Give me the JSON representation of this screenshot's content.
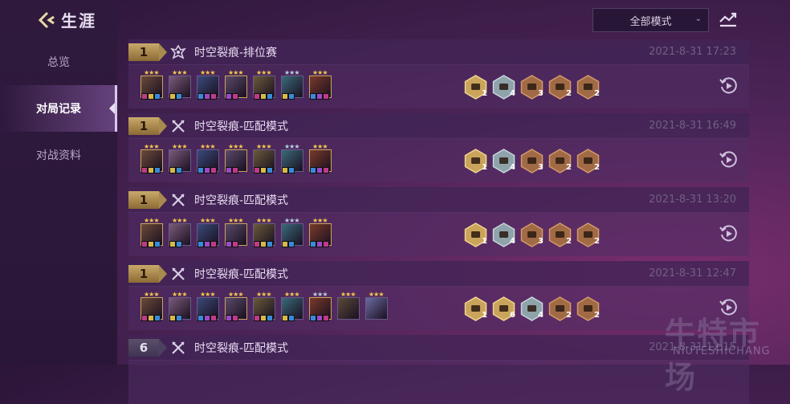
{
  "header": {
    "title": "生涯"
  },
  "sidebar": {
    "items": [
      {
        "label": "总览"
      },
      {
        "label": "对局记录"
      },
      {
        "label": "对战资料"
      }
    ]
  },
  "filter": {
    "mode_value": "全部模式"
  },
  "accent": {
    "gold": "#c9a96a",
    "panel": "#503264",
    "time_text": "#6f6080"
  },
  "matches": [
    {
      "rank": "1",
      "mode": "时空裂痕-排位赛",
      "time": "2021-8-31 17:23",
      "traits": [
        {
          "count": "1",
          "tier": "gold"
        },
        {
          "count": "4",
          "tier": "silver"
        },
        {
          "count": "3",
          "tier": "bronze"
        },
        {
          "count": "2",
          "tier": "bronze"
        },
        {
          "count": "2",
          "tier": "bronze"
        }
      ]
    },
    {
      "rank": "1",
      "mode": "时空裂痕-匹配模式",
      "time": "2021-8-31 16:49",
      "traits": [
        {
          "count": "1",
          "tier": "gold"
        },
        {
          "count": "4",
          "tier": "silver"
        },
        {
          "count": "3",
          "tier": "bronze"
        },
        {
          "count": "2",
          "tier": "bronze"
        },
        {
          "count": "2",
          "tier": "bronze"
        }
      ]
    },
    {
      "rank": "1",
      "mode": "时空裂痕-匹配模式",
      "time": "2021-8-31 13:20",
      "traits": [
        {
          "count": "1",
          "tier": "gold"
        },
        {
          "count": "4",
          "tier": "silver"
        },
        {
          "count": "3",
          "tier": "bronze"
        },
        {
          "count": "2",
          "tier": "bronze"
        },
        {
          "count": "2",
          "tier": "bronze"
        }
      ]
    },
    {
      "rank": "1",
      "mode": "时空裂痕-匹配模式",
      "time": "2021-8-31 12:47",
      "traits": [
        {
          "count": "1",
          "tier": "gold"
        },
        {
          "count": "6",
          "tier": "gold"
        },
        {
          "count": "4",
          "tier": "silver"
        },
        {
          "count": "2",
          "tier": "bronze"
        },
        {
          "count": "2",
          "tier": "bronze"
        }
      ]
    },
    {
      "rank": "6",
      "mode": "时空裂痕-匹配模式",
      "time": "2021-8-31 12:15",
      "traits": []
    }
  ],
  "watermark": {
    "main": "牛特市场",
    "sub": "NIUTESHICHANG"
  }
}
